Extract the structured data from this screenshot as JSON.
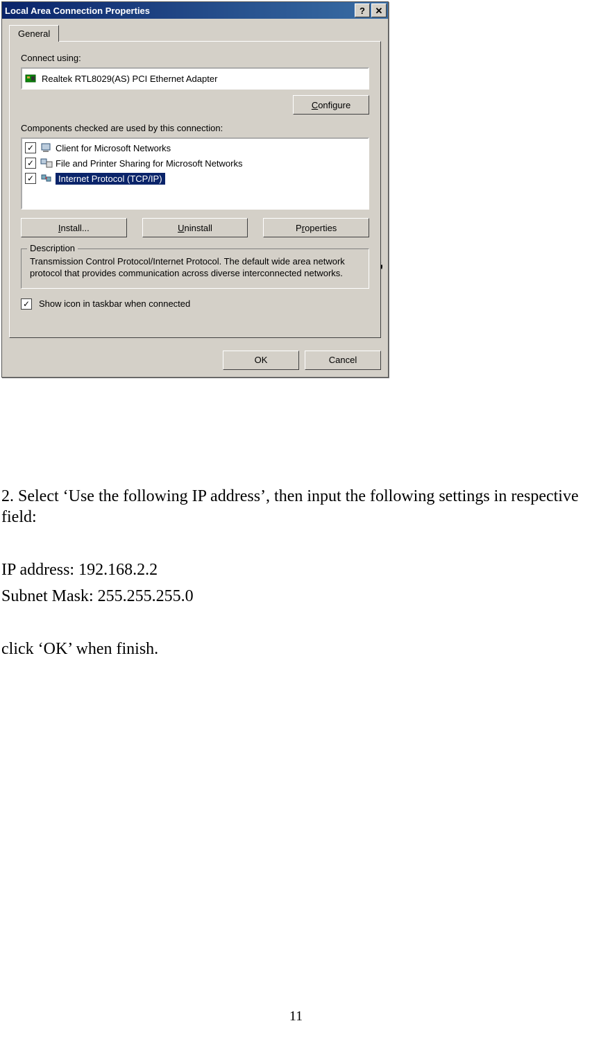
{
  "dialog": {
    "title": "Local Area Connection Properties",
    "tab": "General",
    "connect_using_label": "Connect using:",
    "adapter": "Realtek RTL8029(AS) PCI Ethernet Adapter",
    "configure_btn": "Configure",
    "components_label": "Components checked are used by this connection:",
    "items": [
      {
        "label": "Client for Microsoft Networks",
        "checked": true,
        "selected": false
      },
      {
        "label": "File and Printer Sharing for Microsoft Networks",
        "checked": true,
        "selected": false
      },
      {
        "label": "Internet Protocol (TCP/IP)",
        "checked": true,
        "selected": true
      }
    ],
    "install_btn": "Install...",
    "uninstall_btn": "Uninstall",
    "properties_btn": "Properties",
    "description_legend": "Description",
    "description_text": "Transmission Control Protocol/Internet Protocol. The default wide area network protocol that provides communication across diverse interconnected networks.",
    "show_icon_label": "Show icon in taskbar when connected",
    "ok_btn": "OK",
    "cancel_btn": "Cancel"
  },
  "instructions": {
    "step2": "2. Select ‘Use the following IP address’, then input the following settings in respective field:",
    "ip_line": "IP address: 192.168.2.2",
    "mask_line": "Subnet Mask: 255.255.255.0",
    "click_ok": "click ‘OK’ when finish."
  },
  "page_number": "11"
}
